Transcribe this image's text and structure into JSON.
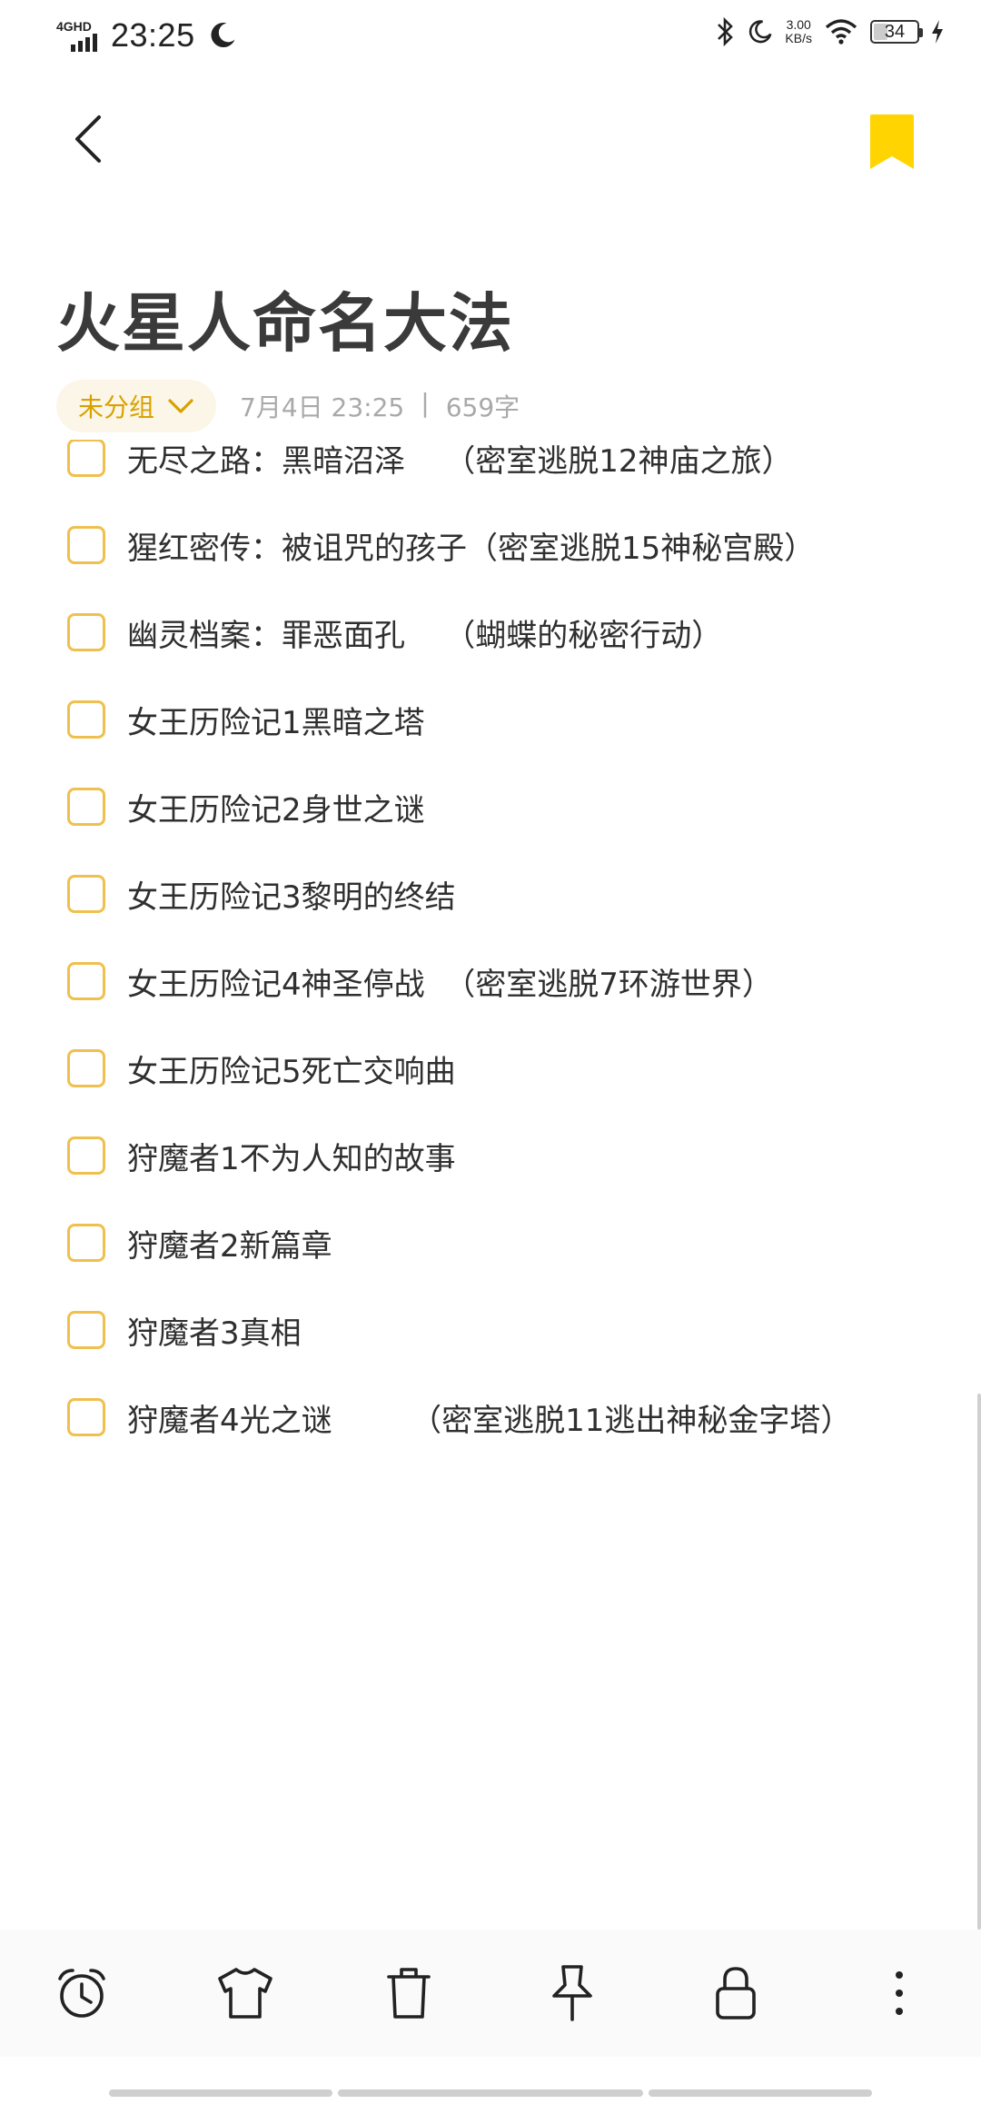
{
  "status_bar": {
    "network": "4GHD",
    "time": "23:25",
    "speed_value": "3.00",
    "speed_unit": "KB/s",
    "battery": "34"
  },
  "header": {
    "title": "火星人命名大法"
  },
  "meta": {
    "group": "未分组",
    "date": "7月4日 23:25",
    "separator": "|",
    "word_count": "659字"
  },
  "checklist": [
    {
      "text": "无尽之路：黑暗沼泽    （密室逃脱12神庙之旅）",
      "checked": false
    },
    {
      "text": "猩红密传：被诅咒的孩子（密室逃脱15神秘宫殿）",
      "checked": false
    },
    {
      "text": "幽灵档案：罪恶面孔    （蝴蝶的秘密行动）",
      "checked": false
    },
    {
      "text": "女王历险记1黑暗之塔",
      "checked": false
    },
    {
      "text": "女王历险记2身世之谜",
      "checked": false
    },
    {
      "text": "女王历险记3黎明的终结",
      "checked": false
    },
    {
      "text": "女王历险记4神圣停战  （密室逃脱7环游世界）",
      "checked": false
    },
    {
      "text": "女王历险记5死亡交响曲",
      "checked": false
    },
    {
      "text": "狩魔者1不为人知的故事",
      "checked": false
    },
    {
      "text": "狩魔者2新篇章",
      "checked": false
    },
    {
      "text": "狩魔者3真相",
      "checked": false
    },
    {
      "text": "狩魔者4光之谜        （密室逃脱11逃出神秘金字塔）",
      "checked": false
    }
  ],
  "toolbar": {
    "items": [
      "alarm-icon",
      "shirt-icon",
      "trash-icon",
      "pin-icon",
      "lock-icon",
      "more-icon"
    ]
  },
  "colors": {
    "accent": "#F0C04F",
    "bookmark": "#FFD400",
    "chip_bg": "#FBF6E8",
    "chip_text": "#D9A100",
    "meta_text": "#A9A9A9"
  }
}
